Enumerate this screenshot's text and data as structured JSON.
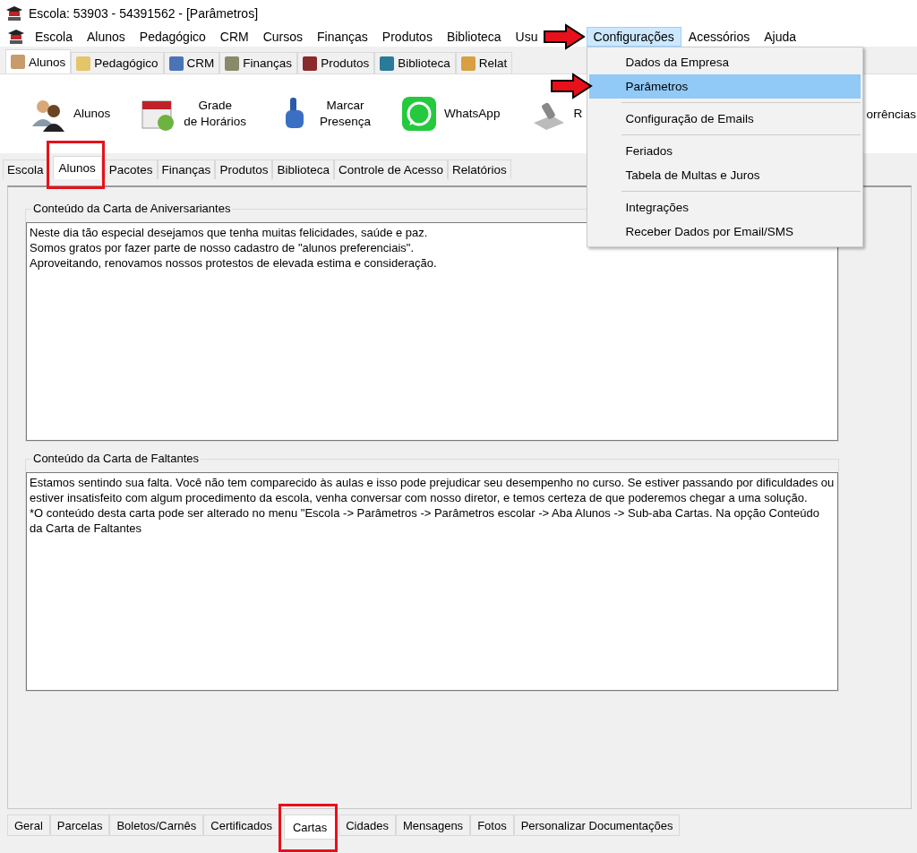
{
  "window": {
    "title": "Escola: 53903 - 54391562 - [Parâmetros]"
  },
  "menu_bar": [
    {
      "label": "Escola",
      "open": false
    },
    {
      "label": "Alunos",
      "open": false
    },
    {
      "label": "Pedagógico",
      "open": false
    },
    {
      "label": "CRM",
      "open": false
    },
    {
      "label": "Cursos",
      "open": false
    },
    {
      "label": "Finanças",
      "open": false
    },
    {
      "label": "Produtos",
      "open": false
    },
    {
      "label": "Biblioteca",
      "open": false
    },
    {
      "label": "Usu",
      "open": false
    },
    {
      "label": "Configurações",
      "open": true
    },
    {
      "label": "Acessórios",
      "open": false
    },
    {
      "label": "Ajuda",
      "open": false
    }
  ],
  "dropdown_menu": [
    {
      "kind": "item",
      "label": "Dados da Empresa",
      "selected": false
    },
    {
      "kind": "item",
      "label": "Parâmetros",
      "selected": true
    },
    {
      "kind": "separator"
    },
    {
      "kind": "item",
      "label": "Configuração de Emails",
      "selected": false
    },
    {
      "kind": "separator"
    },
    {
      "kind": "item",
      "label": "Feriados",
      "selected": false
    },
    {
      "kind": "item",
      "label": "Tabela de Multas e Juros",
      "selected": false
    },
    {
      "kind": "separator"
    },
    {
      "kind": "item",
      "label": "Integrações",
      "selected": false
    },
    {
      "kind": "item",
      "label": "Receber Dados por Email/SMS",
      "selected": false
    }
  ],
  "module_tabs": [
    {
      "label": "Alunos",
      "selected": true
    },
    {
      "label": "Pedagógico",
      "selected": false
    },
    {
      "label": "CRM",
      "selected": false
    },
    {
      "label": "Finanças",
      "selected": false
    },
    {
      "label": "Produtos",
      "selected": false
    },
    {
      "label": "Biblioteca",
      "selected": false
    },
    {
      "label": "Relat",
      "selected": false
    }
  ],
  "toolbar": [
    {
      "label": "Alunos"
    },
    {
      "label": "Grade\nde Horários"
    },
    {
      "label": "Marcar\nPresença"
    },
    {
      "label": "WhatsApp"
    },
    {
      "label": "R"
    }
  ],
  "toolbar_right": {
    "label": "orrências"
  },
  "section_tabs": [
    {
      "label": "Escola",
      "selected": false
    },
    {
      "label": "Alunos",
      "selected": true
    },
    {
      "label": "Pacotes",
      "selected": false
    },
    {
      "label": "Finanças",
      "selected": false
    },
    {
      "label": "Produtos",
      "selected": false
    },
    {
      "label": "Biblioteca",
      "selected": false
    },
    {
      "label": "Controle de Acesso",
      "selected": false
    },
    {
      "label": "Relatórios",
      "selected": false
    }
  ],
  "groups": [
    {
      "title": "Conteúdo da Carta de Aniversariantes",
      "text": "Neste dia tão especial desejamos que tenha muitas felicidades, saúde e paz.\nSomos gratos por fazer parte de nosso cadastro de \"alunos preferenciais\".\nAproveitando, renovamos nossos protestos de elevada estima e consideração."
    },
    {
      "title": "Conteúdo da Carta de Faltantes",
      "text": "Estamos sentindo sua falta. Você não tem comparecido às aulas e isso pode prejudicar seu desempenho no curso. Se estiver passando por dificuldades ou estiver insatisfeito com algum procedimento da escola, venha conversar com nosso diretor, e temos certeza de que poderemos chegar a uma solução.\n*O conteúdo desta carta pode ser alterado no menu \"Escola -> Parâmetros -> Parâmetros escolar -> Aba Alunos -> Sub-aba Cartas. Na opção Conteúdo da Carta de Faltantes"
    }
  ],
  "bottom_tabs": [
    {
      "label": "Geral",
      "selected": false
    },
    {
      "label": "Parcelas",
      "selected": false
    },
    {
      "label": "Boletos/Carnês",
      "selected": false
    },
    {
      "label": "Certificados",
      "selected": false
    },
    {
      "label": "Cartas",
      "selected": true
    },
    {
      "label": "Cidades",
      "selected": false
    },
    {
      "label": "Mensagens",
      "selected": false
    },
    {
      "label": "Fotos",
      "selected": false
    },
    {
      "label": "Personalizar Documentações",
      "selected": false
    }
  ]
}
